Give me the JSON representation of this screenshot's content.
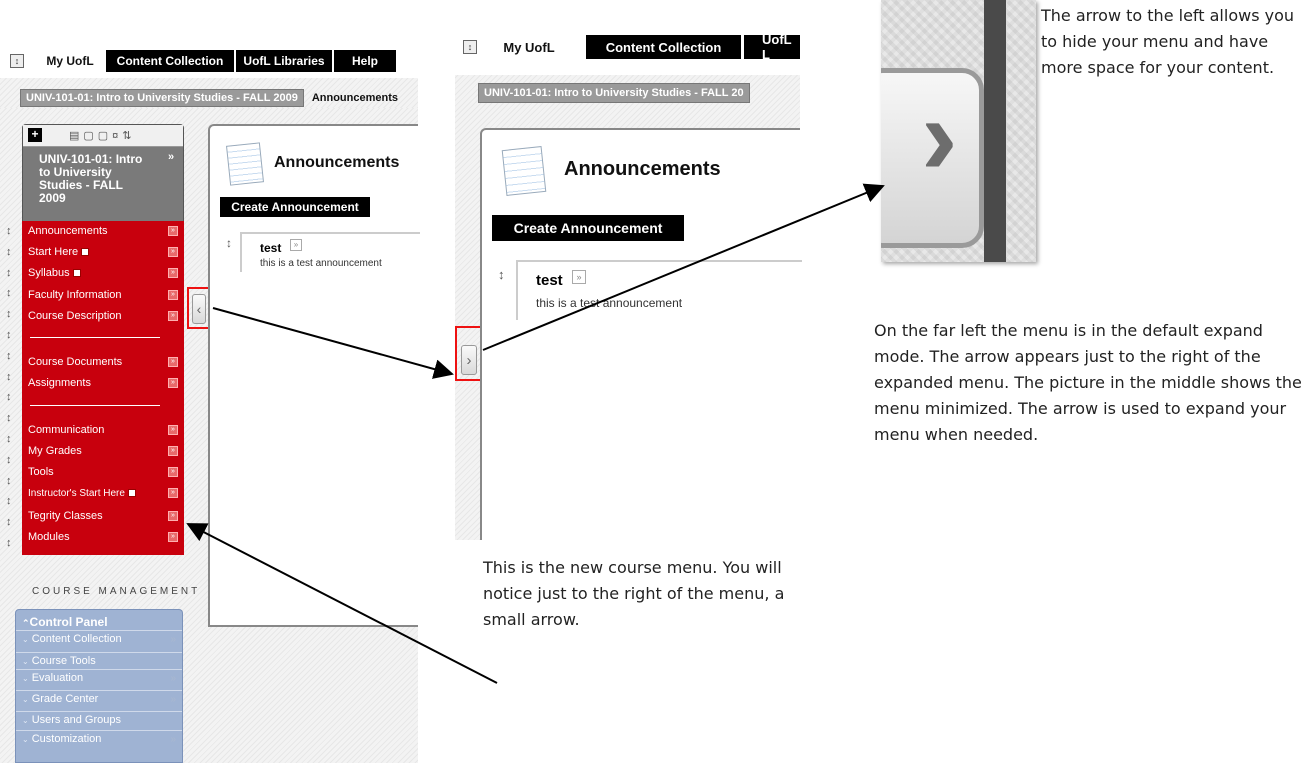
{
  "left_shot": {
    "top_tabs": [
      "My UofL",
      "Content Collection",
      "UofL Libraries",
      "Help"
    ],
    "breadcrumb": [
      "UNIV-101-01: Intro to University Studies - FALL 2009",
      "Announcements"
    ],
    "course_title": "UNIV-101-01: Intro to University Studies - FALL 2009",
    "course_menu": [
      "Announcements",
      "Start Here",
      "Syllabus",
      "Faculty Information",
      "Course Description",
      "Course Documents",
      "Assignments",
      "Communication",
      "My Grades",
      "Tools",
      "Instructor's Start Here",
      "Tegrity Classes",
      "Modules"
    ],
    "course_management_label": "COURSE MANAGEMENT",
    "control_panel": {
      "title": "Control Panel",
      "items": [
        "Content Collection",
        "Course Tools",
        "Evaluation",
        "Grade Center",
        "Users and Groups",
        "Customization"
      ]
    },
    "page_heading": "Announcements",
    "create_button": "Create Announcement",
    "announcement": {
      "title": "test",
      "body": "this is a test announcement"
    }
  },
  "middle_shot": {
    "top_tabs": [
      "My UofL",
      "Content Collection",
      "UofL L"
    ],
    "breadcrumb": "UNIV-101-01: Intro to University Studies - FALL 20",
    "page_heading": "Announcements",
    "create_button": "Create Announcement",
    "announcement": {
      "title": "test",
      "body": "this is a test announcement"
    }
  },
  "annotations": {
    "top_right": "The arrow to the left allows you to hide your menu and have more space for your content.",
    "middle_right": "On the far left the menu is in the default expand mode. The arrow appears just to the right of the expanded menu.  The picture in the middle shows the menu minimized. The arrow is used to expand your menu when needed.",
    "bottom_center": "This is the new course menu. You will notice just to the right of the menu, a small arrow."
  },
  "icons": [
    "page-toggle-icon",
    "add-icon",
    "view-icons",
    "collapse-icon",
    "expand-arrow-icon",
    "chevron-down-icon",
    "notepad-icon",
    "drag-handle-icon"
  ],
  "colors": {
    "menu_red": "#c8000d",
    "control_panel_blue": "#9fb3d3",
    "tab_black": "#000000",
    "callout_red": "#e11111"
  }
}
